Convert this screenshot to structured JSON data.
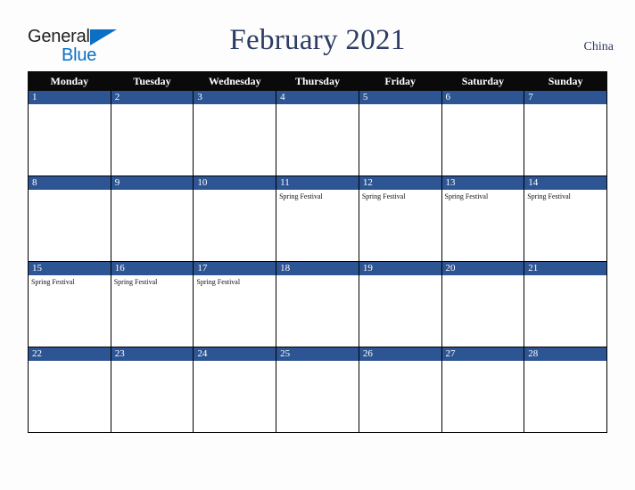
{
  "brand": {
    "name_part1": "General",
    "name_part2": "Blue",
    "color_dark": "#231f20",
    "color_blue": "#0b6fc4"
  },
  "header": {
    "title": "February 2021",
    "country": "China",
    "title_color": "#2c3c63"
  },
  "calendar": {
    "weekday_headers": [
      "Monday",
      "Tuesday",
      "Wednesday",
      "Thursday",
      "Friday",
      "Saturday",
      "Sunday"
    ],
    "header_bg": "#0a0a0a",
    "daynum_bg": "#2e5593",
    "weeks": [
      [
        {
          "day": "1",
          "events": []
        },
        {
          "day": "2",
          "events": []
        },
        {
          "day": "3",
          "events": []
        },
        {
          "day": "4",
          "events": []
        },
        {
          "day": "5",
          "events": []
        },
        {
          "day": "6",
          "events": []
        },
        {
          "day": "7",
          "events": []
        }
      ],
      [
        {
          "day": "8",
          "events": []
        },
        {
          "day": "9",
          "events": []
        },
        {
          "day": "10",
          "events": []
        },
        {
          "day": "11",
          "events": [
            "Spring Festival"
          ]
        },
        {
          "day": "12",
          "events": [
            "Spring Festival"
          ]
        },
        {
          "day": "13",
          "events": [
            "Spring Festival"
          ]
        },
        {
          "day": "14",
          "events": [
            "Spring Festival"
          ]
        }
      ],
      [
        {
          "day": "15",
          "events": [
            "Spring Festival"
          ]
        },
        {
          "day": "16",
          "events": [
            "Spring Festival"
          ]
        },
        {
          "day": "17",
          "events": [
            "Spring Festival"
          ]
        },
        {
          "day": "18",
          "events": []
        },
        {
          "day": "19",
          "events": []
        },
        {
          "day": "20",
          "events": []
        },
        {
          "day": "21",
          "events": []
        }
      ],
      [
        {
          "day": "22",
          "events": []
        },
        {
          "day": "23",
          "events": []
        },
        {
          "day": "24",
          "events": []
        },
        {
          "day": "25",
          "events": []
        },
        {
          "day": "26",
          "events": []
        },
        {
          "day": "27",
          "events": []
        },
        {
          "day": "28",
          "events": []
        }
      ]
    ]
  }
}
